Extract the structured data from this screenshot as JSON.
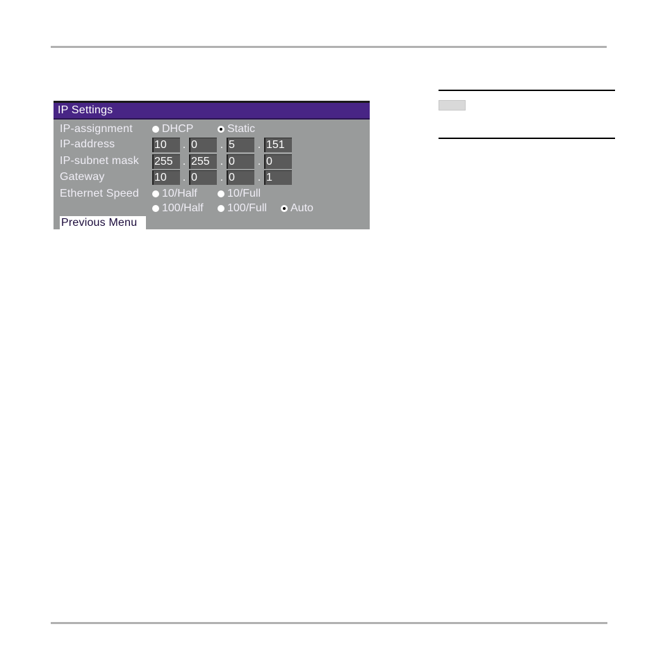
{
  "screen": {
    "title": "IP Settings",
    "colors": {
      "titlebar": "#482585",
      "panel": "#999b9b",
      "field": "#5a5a5a"
    },
    "ip_assignment": {
      "label": "IP-assignment",
      "options": [
        {
          "label": "DHCP",
          "selected": false
        },
        {
          "label": "Static",
          "selected": true
        }
      ]
    },
    "ip_address": {
      "label": "IP-address",
      "octets": [
        "10",
        "0",
        "5",
        "151"
      ]
    },
    "subnet_mask": {
      "label": "IP-subnet mask",
      "octets": [
        "255",
        "255",
        "0",
        "0"
      ]
    },
    "gateway": {
      "label": "Gateway",
      "octets": [
        "10",
        "0",
        "0",
        "1"
      ]
    },
    "separator": ".",
    "ethernet_speed": {
      "label": "Ethernet Speed",
      "options": [
        {
          "label": "10/Half",
          "selected": false
        },
        {
          "label": "10/Full",
          "selected": false
        },
        {
          "label": "100/Half",
          "selected": false
        },
        {
          "label": "100/Full",
          "selected": false
        },
        {
          "label": "Auto",
          "selected": true
        }
      ]
    },
    "previous_menu_label": "Previous Menu"
  }
}
